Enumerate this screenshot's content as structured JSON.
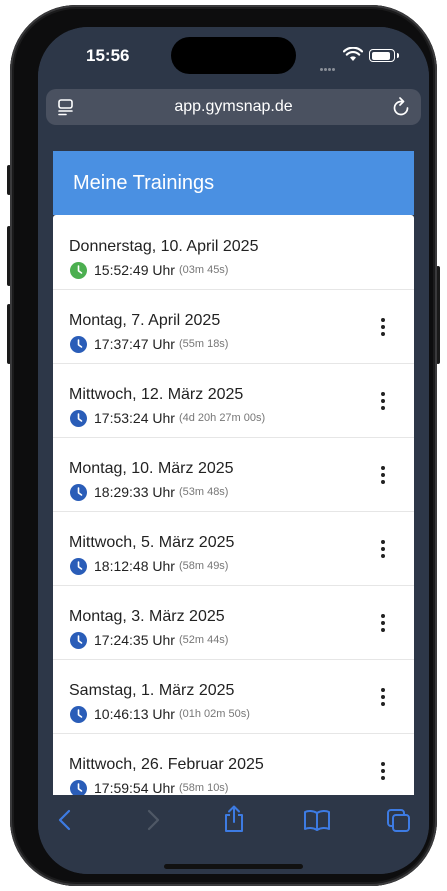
{
  "status_bar": {
    "time": "15:56"
  },
  "browser": {
    "url": "app.gymsnap.de"
  },
  "header": {
    "title": "Meine Trainings"
  },
  "trainings": [
    {
      "date": "Donnerstag, 10. April 2025",
      "time": "15:52:49 Uhr",
      "duration": "(03m 45s)",
      "clock_color": "#4caf50",
      "menu": false
    },
    {
      "date": "Montag, 7. April 2025",
      "time": "17:37:47 Uhr",
      "duration": "(55m 18s)",
      "clock_color": "#2a5db8",
      "menu": true
    },
    {
      "date": "Mittwoch, 12. März 2025",
      "time": "17:53:24 Uhr",
      "duration": "(4d 20h 27m 00s)",
      "clock_color": "#2a5db8",
      "menu": true
    },
    {
      "date": "Montag, 10. März 2025",
      "time": "18:29:33 Uhr",
      "duration": "(53m 48s)",
      "clock_color": "#2a5db8",
      "menu": true
    },
    {
      "date": "Mittwoch, 5. März 2025",
      "time": "18:12:48 Uhr",
      "duration": "(58m 49s)",
      "clock_color": "#2a5db8",
      "menu": true
    },
    {
      "date": "Montag, 3. März 2025",
      "time": "17:24:35 Uhr",
      "duration": "(52m 44s)",
      "clock_color": "#2a5db8",
      "menu": true
    },
    {
      "date": "Samstag, 1. März 2025",
      "time": "10:46:13 Uhr",
      "duration": "(01h 02m 50s)",
      "clock_color": "#2a5db8",
      "menu": true
    },
    {
      "date": "Mittwoch, 26. Februar 2025",
      "time": "17:59:54 Uhr",
      "duration": "(58m 10s)",
      "clock_color": "#2a5db8",
      "menu": true
    }
  ],
  "colors": {
    "header": "#4a90e2",
    "page_bg": "#2d3748",
    "fab": "#2a5db8",
    "toolbar_icons": "#3d7be3"
  }
}
